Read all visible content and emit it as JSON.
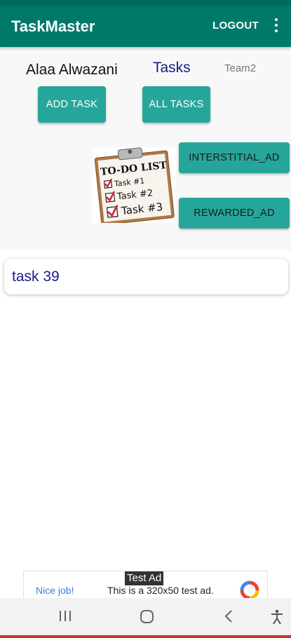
{
  "app_bar": {
    "title": "TaskMaster",
    "logout_label": "LOGOUT",
    "overflow_icon": "more-vert-icon",
    "color": "#00796b"
  },
  "header": {
    "user_name": "Alaa Alwazani",
    "page_heading": "Tasks",
    "team": "Team2"
  },
  "buttons": {
    "add_task": "ADD TASK",
    "all_tasks": "ALL TASKS",
    "interstitial_ad": "INTERSTITIAL_AD",
    "rewarded_ad": "REWARDED_AD",
    "color": "#26a69a"
  },
  "todo_image": {
    "heading": "TO-DO LIST",
    "items": [
      "Task #1",
      "Task #2",
      "Task #3"
    ]
  },
  "tasks": [
    {
      "title": "task 39"
    }
  ],
  "ad": {
    "tag": "Test Ad",
    "headline": "Nice job!",
    "description": "This is a 320x50 test ad."
  },
  "nav_bar": {
    "icons": [
      "recent-apps-icon",
      "home-icon",
      "back-icon",
      "accessibility-icon"
    ]
  }
}
